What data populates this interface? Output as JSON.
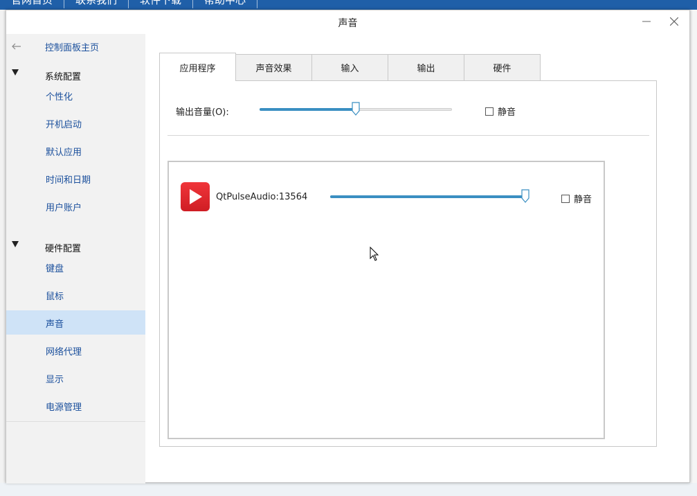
{
  "background": {
    "nav": [
      "官网首页",
      "联系我们",
      "软件下载",
      "帮助中心"
    ]
  },
  "window": {
    "title": "声音"
  },
  "sidebar": {
    "home": "控制面板主页",
    "groups": [
      {
        "label": "系统配置",
        "items": [
          "个性化",
          "开机启动",
          "默认应用",
          "时间和日期",
          "用户账户"
        ]
      },
      {
        "label": "硬件配置",
        "items": [
          "键盘",
          "鼠标",
          "声音",
          "网络代理",
          "显示",
          "电源管理"
        ]
      }
    ],
    "active_item": "声音"
  },
  "tabs": [
    "应用程序",
    "声音效果",
    "输入",
    "输出",
    "硬件"
  ],
  "active_tab": "应用程序",
  "output": {
    "label": "输出音量(O):",
    "volume_fraction": 0.5,
    "mute_label": "静音",
    "muted": false
  },
  "applications": [
    {
      "name": "QtPulseAudio:13564",
      "icon": "play-icon",
      "volume_fraction": 1.0,
      "mute_label": "静音",
      "muted": false
    }
  ],
  "colors": {
    "accent": "#3a8fc2",
    "sidebar_active": "#cfe3f7",
    "link": "#1a4f9c",
    "app_icon": "#e0262d"
  }
}
